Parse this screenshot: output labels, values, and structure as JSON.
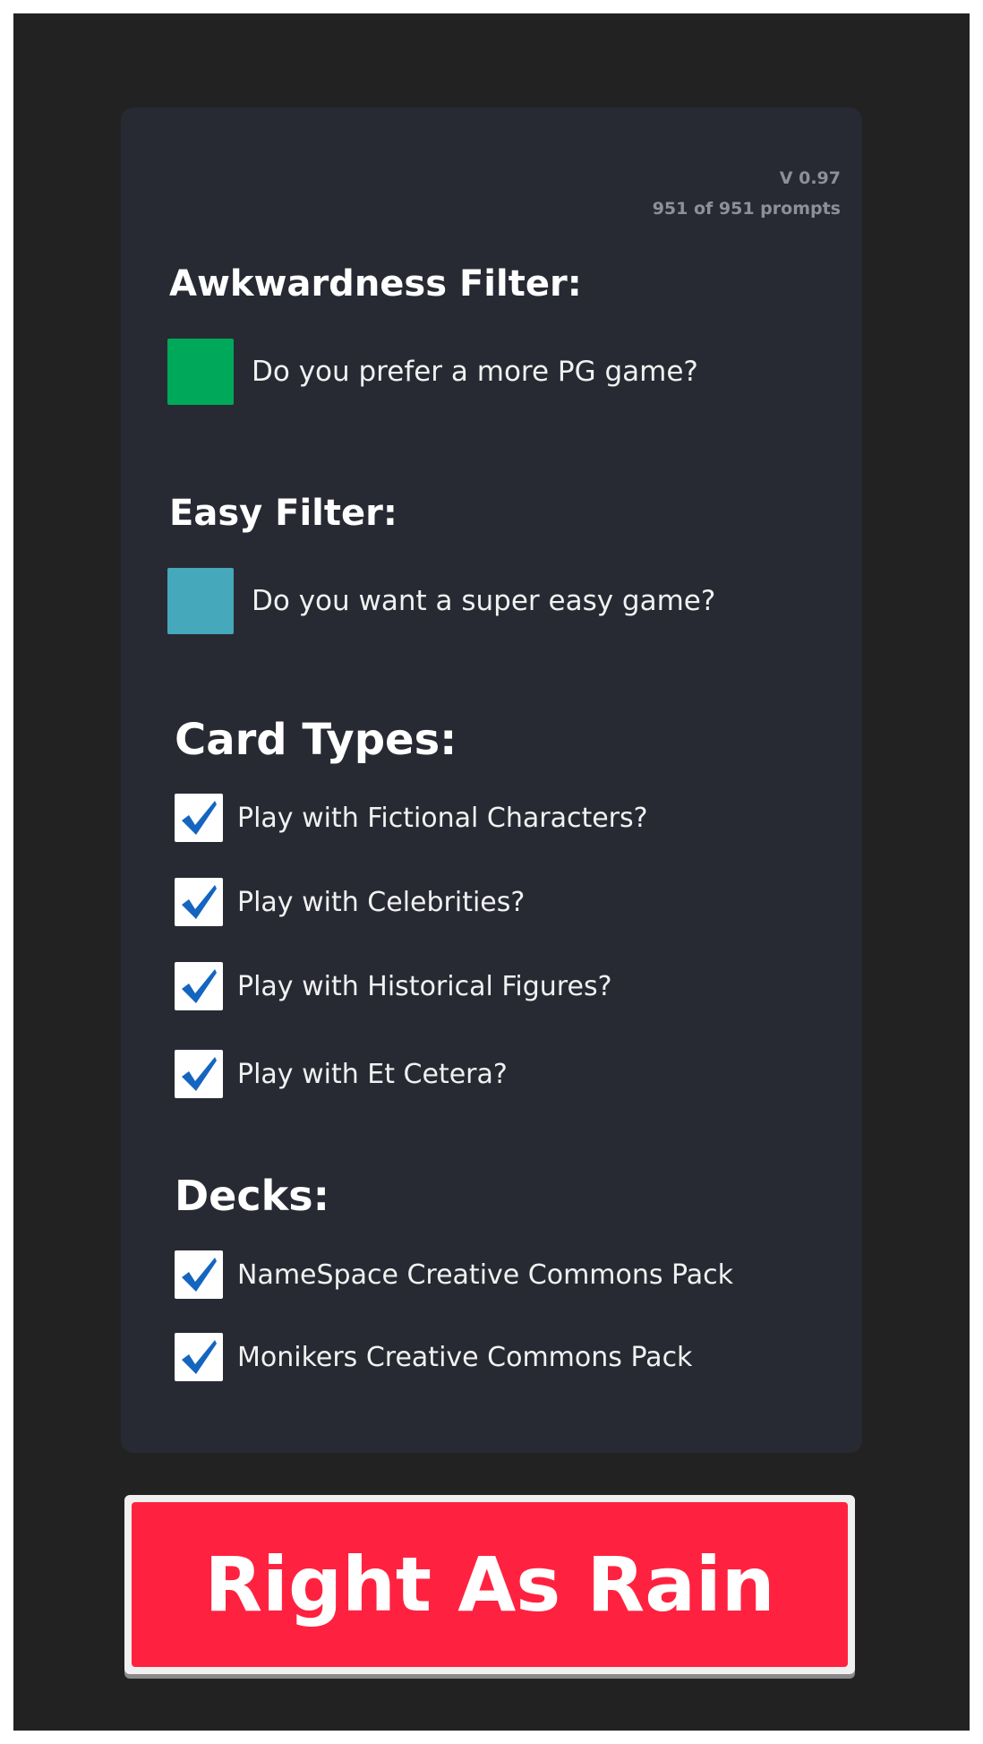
{
  "meta": {
    "version": "V 0.97",
    "prompt_count": "951 of 951 prompts"
  },
  "awkwardness_filter": {
    "heading": "Awkwardness Filter:",
    "label": "Do you prefer a more PG game?",
    "color": "#00a85a"
  },
  "easy_filter": {
    "heading": "Easy Filter:",
    "label": "Do you want a super easy game?",
    "color": "#45a8bb"
  },
  "card_types": {
    "heading": "Card Types:",
    "items": [
      {
        "label": "Play with Fictional Characters?",
        "checked": true
      },
      {
        "label": "Play with Celebrities?",
        "checked": true
      },
      {
        "label": "Play with Historical Figures?",
        "checked": true
      },
      {
        "label": "Play with Et Cetera?",
        "checked": true
      }
    ]
  },
  "decks": {
    "heading": "Decks:",
    "items": [
      {
        "label": "NameSpace Creative Commons Pack",
        "checked": true
      },
      {
        "label": "Monikers Creative Commons Pack",
        "checked": true
      }
    ]
  },
  "main_button": {
    "label": "Right As Rain",
    "color": "#ff2240"
  },
  "colors": {
    "background": "#222222",
    "panel": "#272a33",
    "check": "#1565c0"
  }
}
